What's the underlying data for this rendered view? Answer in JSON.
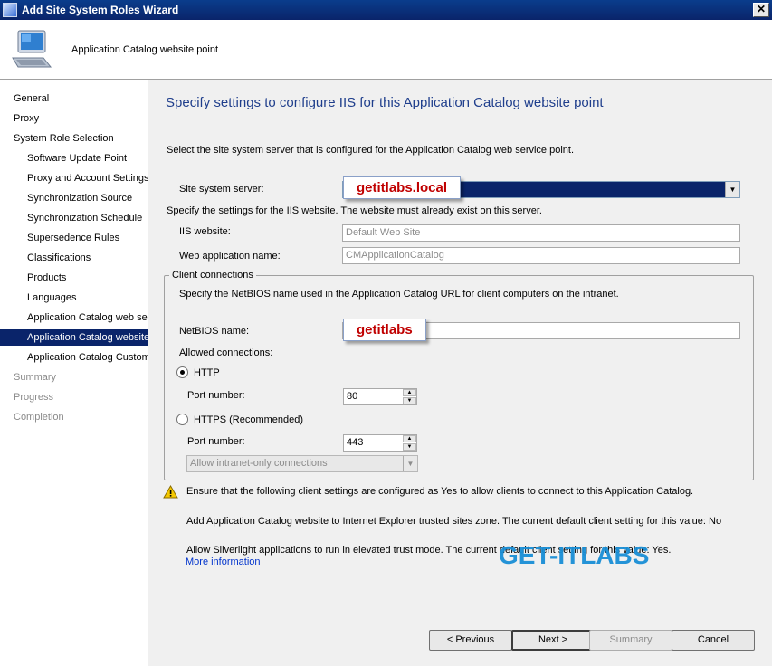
{
  "window": {
    "title": "Add Site System Roles Wizard",
    "close_glyph": "✕"
  },
  "header": {
    "title": "Application Catalog website point"
  },
  "nav": {
    "items": [
      {
        "label": "General",
        "state": "normal"
      },
      {
        "label": "Proxy",
        "state": "normal"
      },
      {
        "label": "System Role Selection",
        "state": "normal"
      },
      {
        "label": "Software Update Point",
        "state": "normal"
      },
      {
        "label": "Proxy and Account Settings",
        "state": "normal"
      },
      {
        "label": "Synchronization Source",
        "state": "normal"
      },
      {
        "label": "Synchronization Schedule",
        "state": "normal"
      },
      {
        "label": "Supersedence Rules",
        "state": "normal"
      },
      {
        "label": "Classifications",
        "state": "normal"
      },
      {
        "label": "Products",
        "state": "normal"
      },
      {
        "label": "Languages",
        "state": "normal"
      },
      {
        "label": "Application Catalog web ser",
        "state": "normal"
      },
      {
        "label": "Application Catalog website",
        "state": "selected"
      },
      {
        "label": "Application Catalog Customi",
        "state": "normal"
      },
      {
        "label": "Summary",
        "state": "disabled"
      },
      {
        "label": "Progress",
        "state": "disabled"
      },
      {
        "label": "Completion",
        "state": "disabled"
      }
    ]
  },
  "main": {
    "title": "Specify settings to configure IIS for this Application Catalog website point",
    "intro": "Select the site system server that is configured for the Application Catalog web service point.",
    "site_server_label": "Site system server:",
    "site_server_callout": "getitlabs.local",
    "iis_intro": "Specify the settings for the IIS website. The website must already exist on this server.",
    "iis_website_label": "IIS website:",
    "iis_website_value": "Default Web Site",
    "webapp_label": "Web application name:",
    "webapp_value": "CMApplicationCatalog",
    "client": {
      "legend": "Client connections",
      "intro": "Specify the NetBIOS name used in the Application Catalog URL for client computers on the intranet.",
      "netbios_label": "NetBIOS name:",
      "netbios_callout": "getitlabs",
      "allowed_label": "Allowed connections:",
      "http_label": "HTTP",
      "http_port_label": "Port number:",
      "http_port": "80",
      "https_label": "HTTPS (Recommended)",
      "https_port_label": "Port number:",
      "https_port": "443",
      "intranet_option": "Allow intranet-only connections"
    },
    "warning": {
      "line1": "Ensure that the following client settings are configured as Yes to allow clients to connect to this Application Catalog.",
      "line2": "Add Application Catalog website to Internet Explorer trusted sites zone. The current default client setting for this value: No",
      "line3": "Allow Silverlight applications to run in elevated trust mode. The current default client setting for this value: Yes.",
      "link": "More information"
    },
    "watermark": "GET-ITLABS"
  },
  "buttons": {
    "previous": "< Previous",
    "next": "Next >",
    "summary": "Summary",
    "cancel": "Cancel"
  },
  "colors": {
    "title_blue": "#1f3e8c",
    "selection": "#0a246a",
    "callout_text": "#c00000",
    "watermark": "#1a8fd6",
    "link": "#0033cc"
  }
}
